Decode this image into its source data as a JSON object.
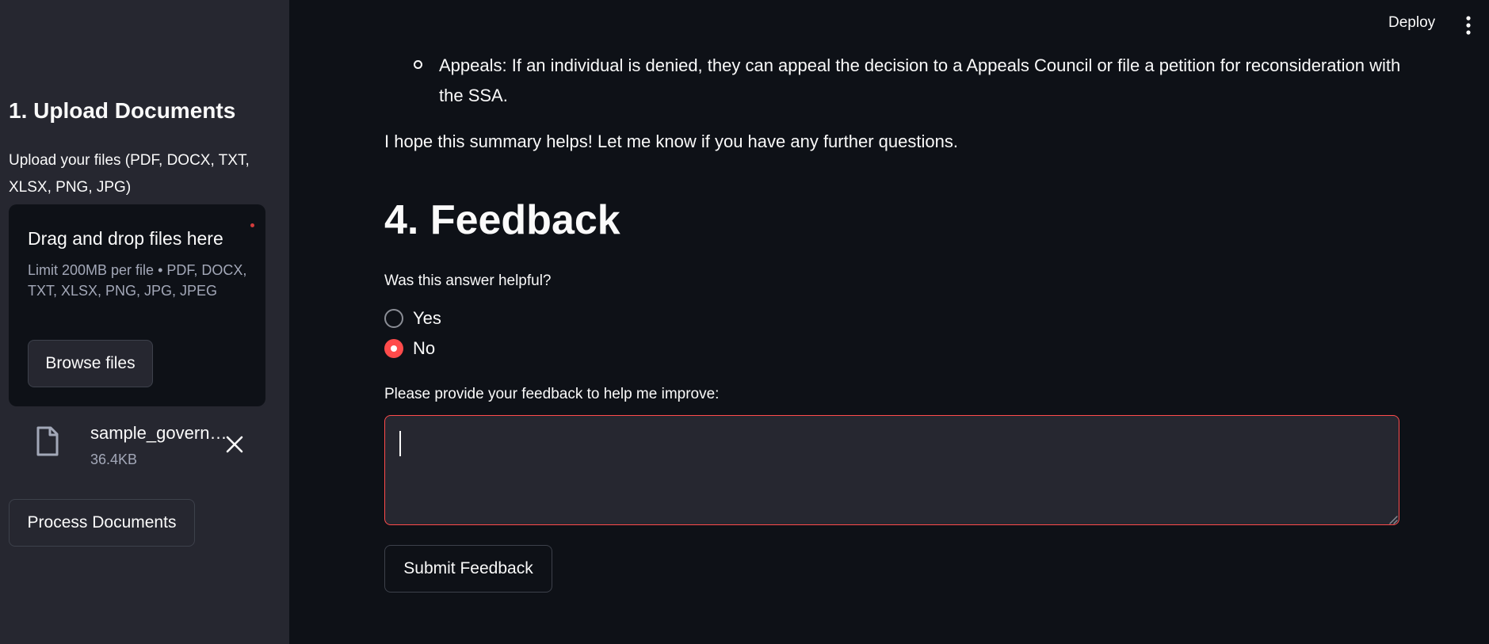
{
  "sidebar": {
    "title": "1. Upload Documents",
    "upload_label": "Upload your files (PDF, DOCX, TXT, XLSX, PNG, JPG)",
    "dropzone": {
      "title": "Drag and drop files here",
      "subtitle": "Limit 200MB per file • PDF, DOCX, TXT, XLSX, PNG, JPG, JPEG",
      "browse_label": "Browse files"
    },
    "file": {
      "name": "sample_government_document",
      "size": "36.4KB",
      "icon": "file-icon"
    },
    "process_label": "Process Documents"
  },
  "header": {
    "deploy_label": "Deploy",
    "menu_icon": "kebab-menu-icon"
  },
  "main": {
    "bullet_text": "Appeals: If an individual is denied, they can appeal the decision to a Appeals Council or file a petition for reconsideration with the SSA.",
    "closing_text": "I hope this summary helps! Let me know if you have any further questions.",
    "feedback_heading": "4. Feedback",
    "helpful_question": "Was this answer helpful?",
    "options": [
      {
        "label": "Yes",
        "selected": false
      },
      {
        "label": "No",
        "selected": true
      }
    ],
    "feedback_label": "Please provide your feedback to help me improve:",
    "feedback_value": "",
    "submit_label": "Submit Feedback"
  },
  "colors": {
    "background": "#0e1117",
    "sidebar": "#262730",
    "accent": "#ff4b4b",
    "text": "#fafafa",
    "muted": "#a3a8b8"
  }
}
